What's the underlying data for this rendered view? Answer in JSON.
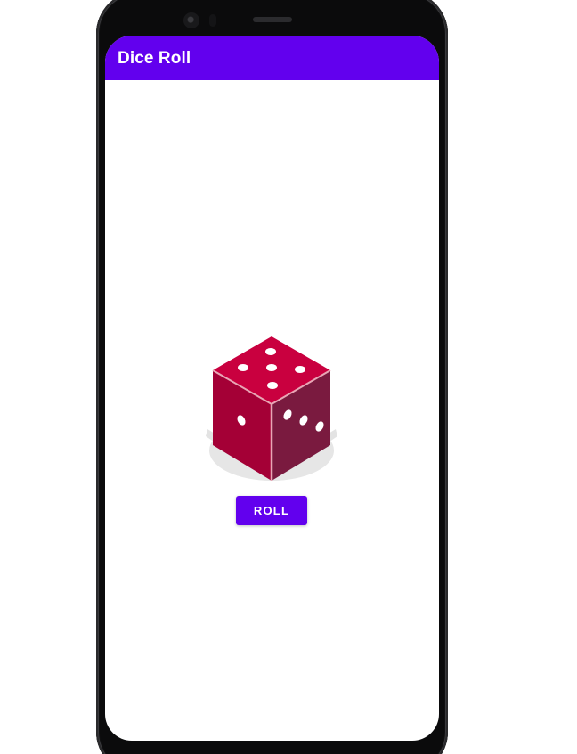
{
  "app": {
    "title": "Dice Roll"
  },
  "dice": {
    "icon": "dice-icon",
    "top_face_pips": 5,
    "left_face_pips": 1,
    "right_face_pips": 3
  },
  "actions": {
    "roll_label": "ROLL"
  },
  "colors": {
    "primary": "#6200ee",
    "dice_top": "#c9003f",
    "dice_left": "#a40036",
    "dice_right": "#7a1a3f"
  }
}
